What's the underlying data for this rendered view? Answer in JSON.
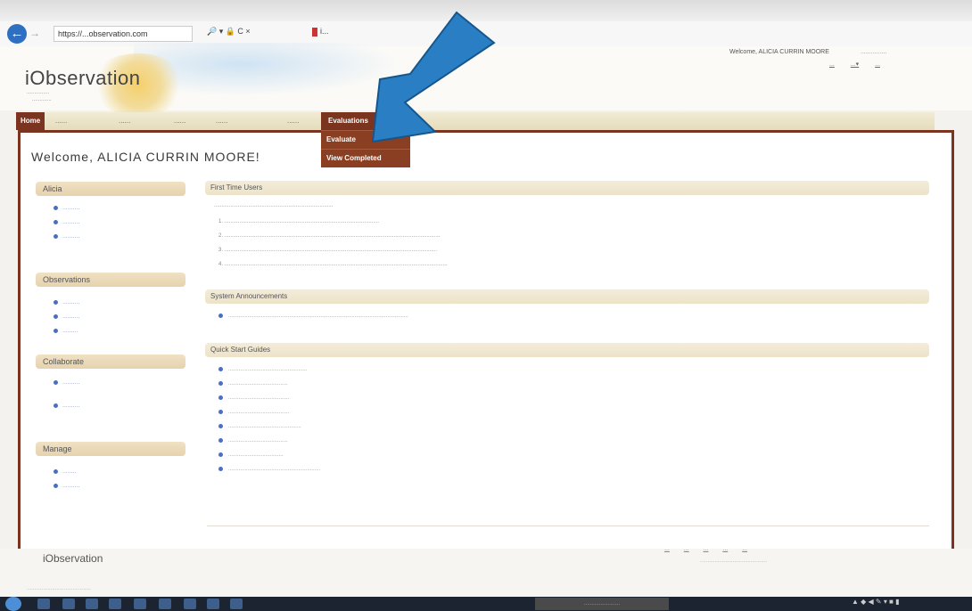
{
  "browser": {
    "url": "https://...observation.com",
    "url_controls": "🔎 ▾ 🔒 C ×",
    "tab_label": "i..."
  },
  "header": {
    "logo": "iObservation",
    "tagline_1": "...............",
    "tagline_2": ".............",
    "welcome_user": "Welcome, ALICIA CURRIN MOORE",
    "institution": "...............",
    "top_links": [
      "...",
      "...▾",
      "..."
    ]
  },
  "nav": {
    "home": "Home",
    "items": [
      "......",
      "......",
      "......",
      "......",
      "......"
    ],
    "active": "Evaluations",
    "dropdown": [
      "Evaluate",
      "View Completed"
    ]
  },
  "page": {
    "welcome_title": "Welcome, ALICIA CURRIN MOORE!"
  },
  "sidebar": {
    "sections": [
      {
        "title": "Alicia",
        "links": [
          "..........",
          "..........",
          ".........."
        ]
      },
      {
        "title": "Observations",
        "links": [
          "..........",
          "..........",
          "........."
        ]
      },
      {
        "title": "Collaborate",
        "links": [
          "..........",
          ".........."
        ]
      },
      {
        "title": "Manage",
        "links": [
          "........",
          ".........."
        ]
      }
    ]
  },
  "main": {
    "sections": [
      {
        "title": "First Time Users"
      },
      {
        "title": "System Announcements"
      },
      {
        "title": "Quick Start Guides"
      }
    ]
  },
  "footer": {
    "logo": "iObservation",
    "links": [
      "...",
      "...",
      "...",
      "...",
      "..."
    ]
  },
  "colors": {
    "accent": "#7b3420",
    "box_tan": "#e6d2ad",
    "arrow": "#2a7fc4"
  }
}
